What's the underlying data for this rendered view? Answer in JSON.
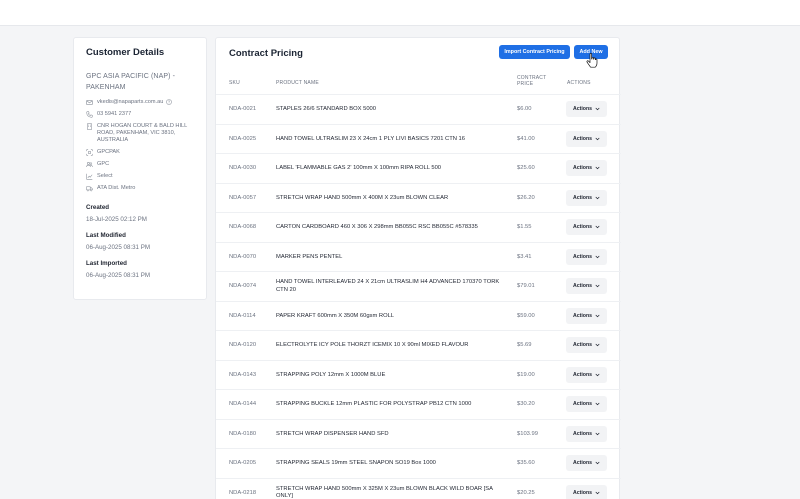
{
  "customer": {
    "title": "Customer Details",
    "name": "GPC ASIA PACIFIC (NAP) - PAKENHAM",
    "email": "vkedis@napaparts.com.au",
    "phone": "03 5941 2377",
    "address": "CNR HOGAN COURT & BALD HILL ROAD, PAKENHAM, VIC 3810, AUSTRALIA",
    "code": "GPCPAK",
    "group": "GPC",
    "pricing": "Select",
    "shipping": "ATA Dist. Metro",
    "created_label": "Created",
    "created_value": "18-Jul-2025 02:12 PM",
    "modified_label": "Last Modified",
    "modified_value": "06-Aug-2025 08:31 PM",
    "imported_label": "Last Imported",
    "imported_value": "06-Aug-2025 08:31 PM"
  },
  "contract": {
    "title": "Contract Pricing",
    "import_label": "Import Contract Pricing",
    "add_label": "Add New",
    "columns": {
      "sku": "SKU",
      "name": "PRODUCT NAME",
      "price_line1": "CONTRACT",
      "price_line2": "PRICE",
      "actions": "ACTIONS"
    },
    "action_label": "Actions",
    "rows": [
      {
        "sku": "NDA-0021",
        "name": "STAPLES 26/6 STANDARD BOX 5000",
        "price": "$6.00"
      },
      {
        "sku": "NDA-0025",
        "name": "HAND TOWEL ULTRASLIM 23 X 24cm 1 PLY LIVI BASICS 7201 CTN 16",
        "price": "$41.00"
      },
      {
        "sku": "NDA-0030",
        "name": "LABEL 'FLAMMABLE GAS 2' 100mm X 100mm RIPA ROLL 500",
        "price": "$25.60"
      },
      {
        "sku": "NDA-0057",
        "name": "STRETCH WRAP HAND 500mm X 400M X 23um BLOWN CLEAR",
        "price": "$26.20"
      },
      {
        "sku": "NDA-0068",
        "name": "CARTON CARDBOARD 460 X 306 X 298mm BB055C RSC BB055C #578335",
        "price": "$1.55"
      },
      {
        "sku": "NDA-0070",
        "name": "MARKER PENS PENTEL",
        "price": "$3.41"
      },
      {
        "sku": "NDA-0074",
        "name": "HAND TOWEL INTERLEAVED 24 X 21cm ULTRASLIM H4 ADVANCED 170370 TORK CTN 20",
        "price": "$79.01"
      },
      {
        "sku": "NDA-0114",
        "name": "PAPER KRAFT 600mm X 350M 60gsm ROLL",
        "price": "$59.00"
      },
      {
        "sku": "NDA-0120",
        "name": "ELECTROLYTE ICY POLE THORZT ICEMIX 10 X 90ml MIXED FLAVOUR",
        "price": "$5.69"
      },
      {
        "sku": "NDA-0143",
        "name": "STRAPPING POLY 12mm X 1000M BLUE",
        "price": "$19.00"
      },
      {
        "sku": "NDA-0144",
        "name": "STRAPPING BUCKLE 12mm PLASTIC FOR POLYSTRAP PB12 CTN 1000",
        "price": "$30.20"
      },
      {
        "sku": "NDA-0180",
        "name": "STRETCH WRAP DISPENSER HAND SFD",
        "price": "$103.99"
      },
      {
        "sku": "NDA-0205",
        "name": "STRAPPING SEALS 19mm STEEL SNAPON SO19 Box 1000",
        "price": "$35.60"
      },
      {
        "sku": "NDA-0218",
        "name": "STRETCH WRAP HAND 500mm X 325M X 23um BLOWN BLACK WILD BOAR [SA ONLY]",
        "price": "$20.25"
      }
    ]
  },
  "colors": {
    "primary": "#1f6fe5",
    "background": "#f4f5f7",
    "muted_text": "#6b7280"
  }
}
